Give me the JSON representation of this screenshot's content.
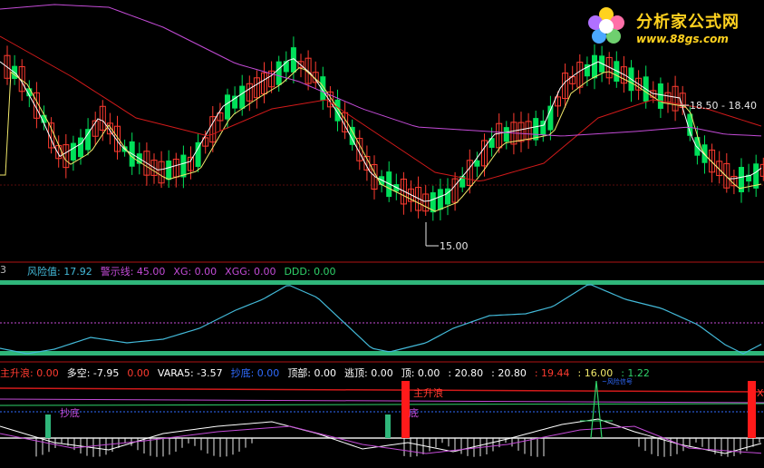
{
  "colors": {
    "up": "#ff3b30",
    "down": "#00e05a",
    "ma_white": "#ffffff",
    "ma_yellow": "#f2e96b",
    "ma_red": "#d11a1a",
    "ma_purple": "#c34bd6",
    "risk_line": "#43b9d8",
    "warning_line": "#c34bd6",
    "separator": "#b01515",
    "bar_green": "#2fb67a",
    "bar_red": "#ff1a1a"
  },
  "logo": {
    "title": "分析家公式网",
    "url": "www.88gs.com",
    "icon": "flower-logo-icon"
  },
  "price_panel": {
    "low_annotation": "15.00",
    "high_annotation": "18.50 - 18.40"
  },
  "risk_panel": {
    "left_cut": "3",
    "items": [
      {
        "label": "风险值: 17.92",
        "color": "#43b9d8"
      },
      {
        "label": "警示线: 45.00",
        "color": "#c34bd6"
      },
      {
        "label": "XG: 0.00",
        "color": "#c34bd6"
      },
      {
        "label": "XGG: 0.00",
        "color": "#c34bd6"
      },
      {
        "label": "DDD: 0.00",
        "color": "#2fd36a"
      }
    ]
  },
  "signal_panel": {
    "items": [
      {
        "label": "主升浪: 0.00",
        "color": "#ff3b30"
      },
      {
        "label": "多空: -7.95",
        "color": "#ffffff"
      },
      {
        "label": "0.00",
        "color": "#ff3b30"
      },
      {
        "label": "VARA5: -3.57",
        "color": "#ffffff"
      },
      {
        "label": "抄底: 0.00",
        "color": "#2f6bff"
      },
      {
        "label": "顶部: 0.00",
        "color": "#ffffff"
      },
      {
        "label": "逃顶: 0.00",
        "color": "#ffffff"
      },
      {
        "label": "顶: 0.00",
        "color": "#ffffff"
      },
      {
        "label": ": 20.80",
        "color": "#ffffff"
      },
      {
        "label": ": 20.80",
        "color": "#ffffff"
      },
      {
        "label": ": 19.44",
        "color": "#ff3b30"
      },
      {
        "label": ": 16.00",
        "color": "#f2e96b"
      },
      {
        "label": ": 1.22",
        "color": "#2fd36a"
      }
    ],
    "labels": {
      "chaodi_1": "抄底",
      "zhushenglang": "主升浪",
      "chaodi_2": "底",
      "small_signal": "~风险信号",
      "right_cut": "X"
    }
  }
}
